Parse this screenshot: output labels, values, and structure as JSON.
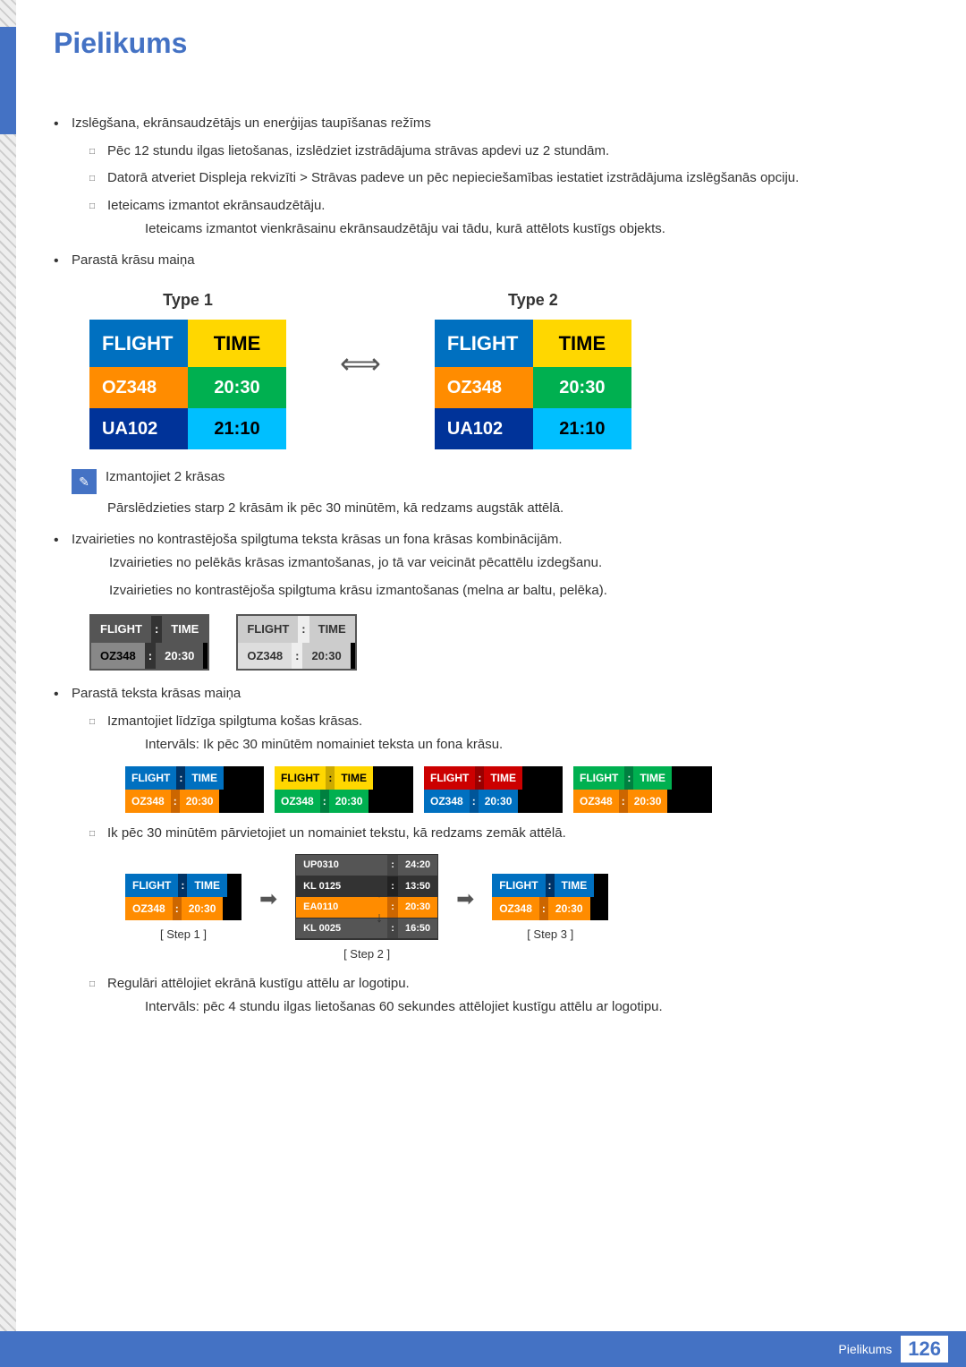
{
  "page": {
    "title": "Pielikums",
    "footer_label": "Pielikums",
    "footer_number": "126"
  },
  "content": {
    "bullet1": "Izslēgšana, ekrānsaudzētājs un enerģijas taupīšanas režīms",
    "sub1_1": "Pēc 12 stundu ilgas lietošanas, izslēdziet izstrādājuma strāvas apdevi uz 2 stundām.",
    "sub1_2": "Datorā atveriet Displeja rekvizīti > Strāvas padeve un pēc nepieciešamības iestatiet izstrādājuma izslēgšanās opciju.",
    "sub1_3": "Ieteicams izmantot ekrānsaudzētāju.",
    "sub1_3_indent": "Ieteicams izmantot vienkrāsainu ekrānsaudzētāju vai tādu, kurā attēlots kustīgs objekts.",
    "bullet2": "Parastā krāsu maiņa",
    "type1_label": "Type 1",
    "type2_label": "Type 2",
    "flight_label": "FLIGHT",
    "time_label": "TIME",
    "oz348": "OZ348",
    "time1": "20:30",
    "ua102": "UA102",
    "time2": "21:10",
    "note_text": "Izmantojiet 2 krāsas",
    "note_sub": "Pārslēdzieties starp 2 krāsām ik pēc 30 minūtēm, kā redzams augstāk attēlā.",
    "bullet3_1": "Izvairieties no kontrastējoša spilgtuma teksta krāsas un fona krāsas kombinācijām.",
    "bullet3_2": "Izvairieties no pelēkās krāsas izmantošanas, jo tā var veicināt pēcattēlu izdegšanu.",
    "bullet3_3": "Izvairieties no kontrastējoša spilgtuma krāsu izmantošanas (melna ar baltu, pelēka).",
    "bullet4": "Parastā teksta krāsas maiņa",
    "sub4_1": "Izmantojiet līdzīga spilgtuma košas krāsas.",
    "sub4_1_indent": "Intervāls: Ik pēc 30 minūtēm nomainiet teksta un fona krāsu.",
    "sub4_2": "Ik pēc 30 minūtēm pārvietojiet un nomainiet tekstu, kā redzams zemāk attēlā.",
    "step1_label": "[ Step 1 ]",
    "step2_label": "[ Step 2 ]",
    "step3_label": "[ Step 3 ]",
    "step2_data": [
      {
        "col1": "UP0310",
        "col2": "24:20"
      },
      {
        "col1": "KL 0125",
        "col2": "13:50"
      },
      {
        "col1": "EA0110",
        "col2": "20:30"
      },
      {
        "col1": "KL 0025",
        "col2": "16:50"
      }
    ],
    "sub4_3": "Regulāri attēlojiet ekrānā kustīgu attēlu ar logotipu.",
    "sub4_3_indent": "Intervāls: pēc 4 stundu ilgas lietošanas 60 sekundes attēlojiet kustīgu attēlu ar logotipu."
  }
}
